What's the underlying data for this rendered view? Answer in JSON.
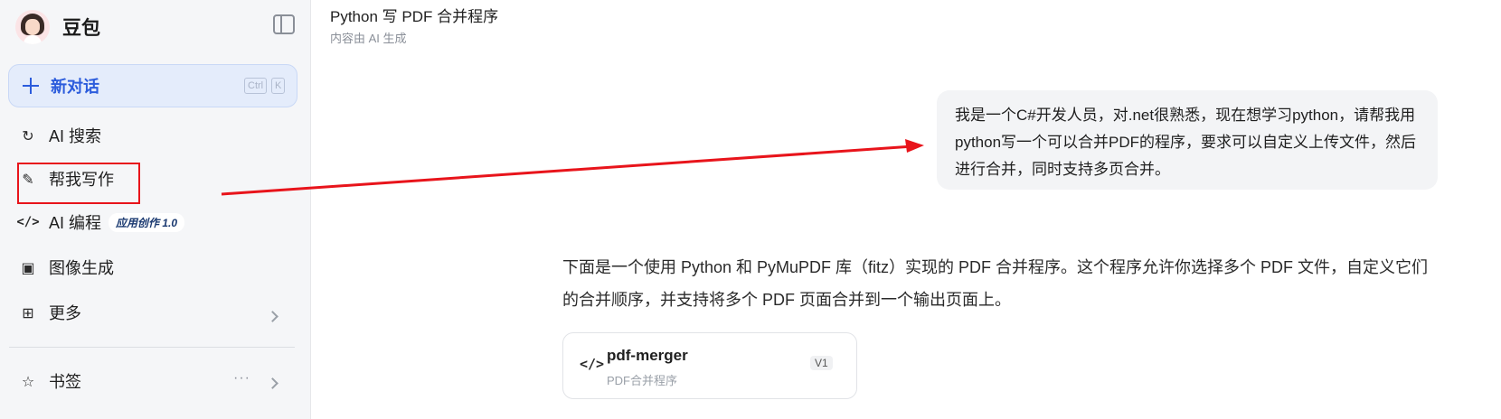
{
  "sidebar": {
    "brand": "豆包",
    "new_chat": {
      "label": "新对话",
      "shortcut_ctrl": "Ctrl",
      "shortcut_key": "K"
    },
    "items": [
      {
        "label": "AI 搜索",
        "icon": "ai-search-icon"
      },
      {
        "label": "帮我写作",
        "icon": "pen-icon"
      },
      {
        "label": "AI 编程",
        "icon": "code-icon",
        "badge": "应用创作 1.0"
      },
      {
        "label": "图像生成",
        "icon": "image-icon"
      },
      {
        "label": "更多",
        "icon": "grid-icon"
      }
    ],
    "bookmarks": {
      "label": "书签",
      "icon": "star-icon",
      "more": "···"
    }
  },
  "header": {
    "title": "Python 写 PDF 合并程序",
    "subtitle": "内容由 AI 生成"
  },
  "chat": {
    "user_message": "我是一个C#开发人员，对.net很熟悉，现在想学习python，请帮我用python写一个可以合并PDF的程序，要求可以自定义上传文件，然后进行合并，同时支持多页合并。",
    "reply": "下面是一个使用 Python 和 PyMuPDF 库（fitz）实现的 PDF 合并程序。这个程序允许你选择多个 PDF 文件，自定义它们的合并顺序，并支持将多个 PDF 页面合并到一个输出页面上。",
    "code_card": {
      "name": "pdf-merger",
      "description": "PDF合并程序",
      "version": "V1"
    }
  },
  "annotation": {
    "highlight_color": "#e8141b"
  }
}
